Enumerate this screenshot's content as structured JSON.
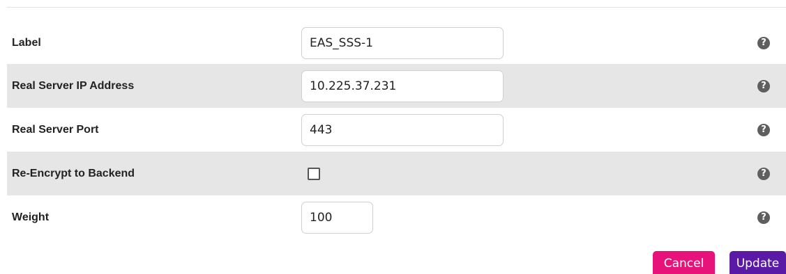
{
  "form": {
    "rows": [
      {
        "label": "Label",
        "value": "EAS_SSS-1"
      },
      {
        "label": "Real Server IP Address",
        "value": "10.225.37.231"
      },
      {
        "label": "Real Server Port",
        "value": "443"
      },
      {
        "label": "Re-Encrypt to Backend",
        "checked": false
      },
      {
        "label": "Weight",
        "value": "100"
      }
    ],
    "help_glyph": "?"
  },
  "actions": {
    "cancel_label": "Cancel",
    "update_label": "Update"
  },
  "colors": {
    "row_shade": "#e6e6e6",
    "cancel": "#e8127b",
    "update": "#5b1aa6",
    "help_icon": "#5f5f5f"
  },
  "icons": {
    "help": "question-circle-icon"
  }
}
